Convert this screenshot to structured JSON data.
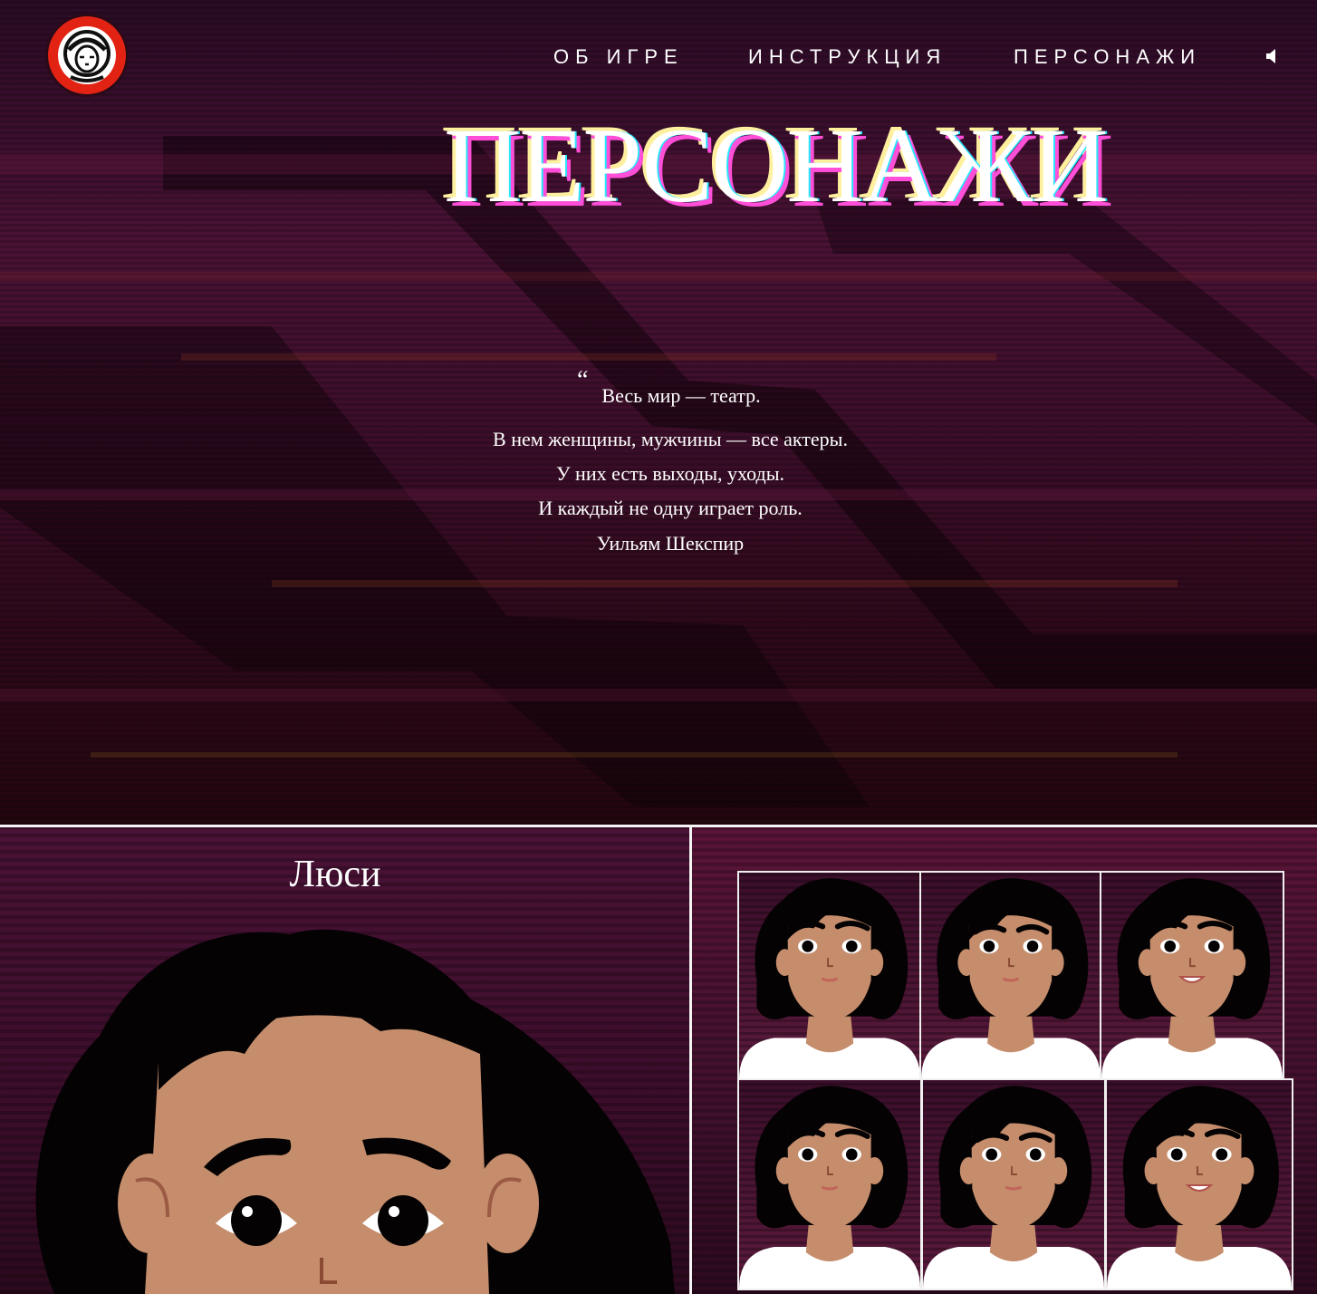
{
  "nav": {
    "items": [
      {
        "label": "ОБ ИГРЕ"
      },
      {
        "label": "ИНСТРУКЦИЯ"
      },
      {
        "label": "ПЕРСОНАЖИ"
      }
    ],
    "sound_icon": "speaker-icon"
  },
  "logo": {
    "icon": "cosmonaut-logo-icon"
  },
  "hero": {
    "title": "ПЕРСОНАЖИ",
    "quote_mark": "“",
    "quote_lines": [
      "Весь мир — театр.",
      "В нем женщины, мужчины — все актеры.",
      "У них есть выходы, уходы.",
      "И каждый не одну играет роль."
    ],
    "author": "Уильям Шекспир"
  },
  "character": {
    "name": "Люси",
    "expressions": [
      "neutral",
      "frown",
      "smile",
      "neutral-2",
      "frown-2",
      "smile-2"
    ]
  },
  "colors": {
    "logo_red": "#e22313",
    "glitch_cyan": "#27e6ff",
    "glitch_magenta": "#ff4fd8",
    "glitch_yellow": "#fff0a0",
    "skin": "#c58d6c",
    "hair": "#050203"
  }
}
